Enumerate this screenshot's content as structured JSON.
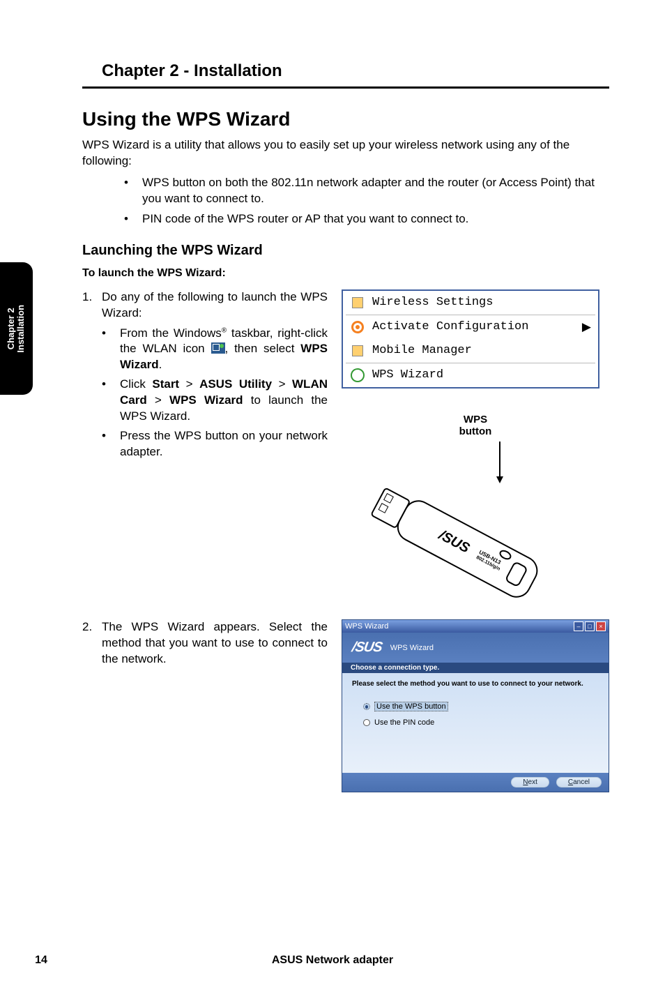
{
  "sideTab": {
    "line1": "Chapter 2",
    "line2": "Installation"
  },
  "chapterHeader": "Chapter 2 - Installation",
  "h2": "Using the WPS Wizard",
  "intro": "WPS Wizard is a utility that allows you to easily set up your wireless network using any of the following:",
  "topBullets": [
    "WPS button on both the 802.11n network adapter and the router (or Access Point) that you want to connect to.",
    "PIN code of the WPS router or AP that you want to connect to."
  ],
  "h3": "Launching the WPS Wizard",
  "h4": "To launch the WPS Wizard:",
  "step1": {
    "num": "1.",
    "text": "Do any of the following to launch the WPS Wizard:",
    "sub": [
      {
        "pre": "From the Windows",
        "sup": "®",
        "mid": " taskbar, right-click the WLAN icon ",
        "post": ", then select ",
        "bold": "WPS Wizard",
        "end": "."
      },
      {
        "text": "Click ",
        "b1": "Start",
        "gt1": " > ",
        "b2": "ASUS Utility",
        "gt2": " > ",
        "b3": "WLAN Card",
        "gt3": " > ",
        "b4": "WPS Wizard",
        "end": " to launch the WPS Wizard."
      },
      {
        "text": "Press the WPS button on your network adapter."
      }
    ]
  },
  "ctxMenu": {
    "row1": "Wireless Settings",
    "row2": "Activate Configuration",
    "row3": "Mobile Manager",
    "row4": "WPS Wizard"
  },
  "adapter": {
    "label1": "WPS",
    "label2": "button",
    "brand": "/SUS",
    "model1": "USB-N13",
    "model2": "802.11b/g/n"
  },
  "step2": {
    "num": "2.",
    "text": "The WPS Wizard appears. Select the method that you want to use to connect to the network."
  },
  "wizard": {
    "titlebar": "WPS Wizard",
    "brandLogo": "/SUS",
    "brandTitle": "WPS Wizard",
    "strip": "Choose a connection type.",
    "prompt": "Please select the method you want to use to connect to your network.",
    "opt1": "Use the WPS button",
    "opt2": "Use the PIN code",
    "btnNext": "Next",
    "btnCancel": "Cancel"
  },
  "footer": {
    "page": "14",
    "title": "ASUS Network adapter"
  }
}
